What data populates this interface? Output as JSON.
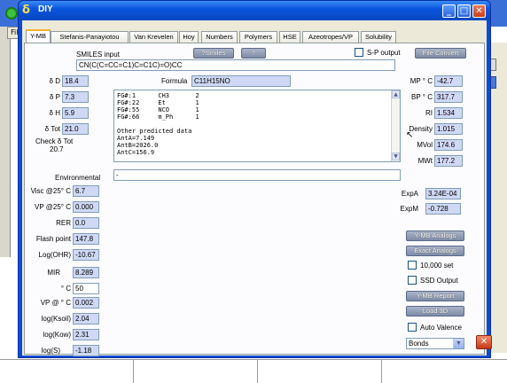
{
  "window": {
    "title": "DIY",
    "title_icon": "δ"
  },
  "behind": {
    "file_menu": "Fil"
  },
  "tabs": [
    {
      "label": "Y-MB",
      "active": true
    },
    {
      "label": "Stefanis-Panayiotou"
    },
    {
      "label": "Van Krevelen"
    },
    {
      "label": "Hoy"
    },
    {
      "label": "Numbers"
    },
    {
      "label": "Polymers"
    },
    {
      "label": "HSE"
    },
    {
      "label": "Azeotropes/VP"
    },
    {
      "label": "Solubility"
    }
  ],
  "smiles": {
    "label": "SMILES input",
    "value": "CN(C(C=CC=C1)C=C1C)=O)CC",
    "smiles_button": "?Smiles",
    "help_button": "?",
    "sp_output_label": "S-P output",
    "file_convert_button": "File Convert"
  },
  "formula": {
    "label": "Formula",
    "value": "C11H15NO"
  },
  "left": {
    "dD": {
      "label": "δ D",
      "value": "18.4"
    },
    "dP": {
      "label": "δ P",
      "value": "7.3"
    },
    "dH": {
      "label": "δ H",
      "value": "5.9"
    },
    "dTot": {
      "label": "δ Tot",
      "value": "21.0"
    },
    "check_label": "Check  δ Tot",
    "check_value": "20.7"
  },
  "fg_text": "FG#:1      CH3       2\nFG#:22     Et        1\nFG#:55     NCO       1\nFG#:66     m_Ph      1\n\nOther predicted data\nAntA=7.149\nAntB=2026.0\nAntC=156.9",
  "right": {
    "mp": {
      "label": "MP ° C",
      "value": "-42.7"
    },
    "bp": {
      "label": "BP ° C",
      "value": "317.7"
    },
    "ri": {
      "label": "RI",
      "value": "1.534"
    },
    "density": {
      "label": "Density",
      "value": "1.015"
    },
    "mvol": {
      "label": "MVol",
      "value": "174.6"
    },
    "mwt": {
      "label": "MWt",
      "value": "177.2"
    }
  },
  "environmental": {
    "label": "Environmental",
    "value": "-"
  },
  "env": {
    "visc": {
      "label": "Visc @25° C",
      "value": "6.7"
    },
    "vp": {
      "label": "VP @25° C",
      "value": "0.000"
    },
    "rer": {
      "label": "RER",
      "value": "0.0"
    },
    "flash": {
      "label": "Flash point",
      "value": "147.8"
    },
    "logohr": {
      "label": "Log(OHR)",
      "value": "-10.67"
    },
    "mir": {
      "label": "MIR",
      "value": "8.289"
    },
    "temp": {
      "label": "° C",
      "value": "50"
    },
    "vpt": {
      "label": "VP @ ° C",
      "value": "0.002"
    },
    "logksoil": {
      "label": "log(Ksoil)",
      "value": "2.04"
    },
    "logkow": {
      "label": "log(Kow)",
      "value": "2.31"
    },
    "logs": {
      "label": "log(S)",
      "value": "-1.18"
    }
  },
  "exp": {
    "expA": {
      "label": "ExpA",
      "value": "3.24E-04"
    },
    "expM": {
      "label": "ExpM",
      "value": "-0.728"
    }
  },
  "actions": {
    "ymb_analogs": "Y-MB Analogs",
    "exact_analogs": "Exact Analogs",
    "set10000": "10,000 set",
    "ssd_output": "SSD Output",
    "ymb_report": "Y-MB Report",
    "load3d": "Load 3D",
    "auto_valence": "Auto Valence",
    "bonds_select": "Bonds"
  }
}
